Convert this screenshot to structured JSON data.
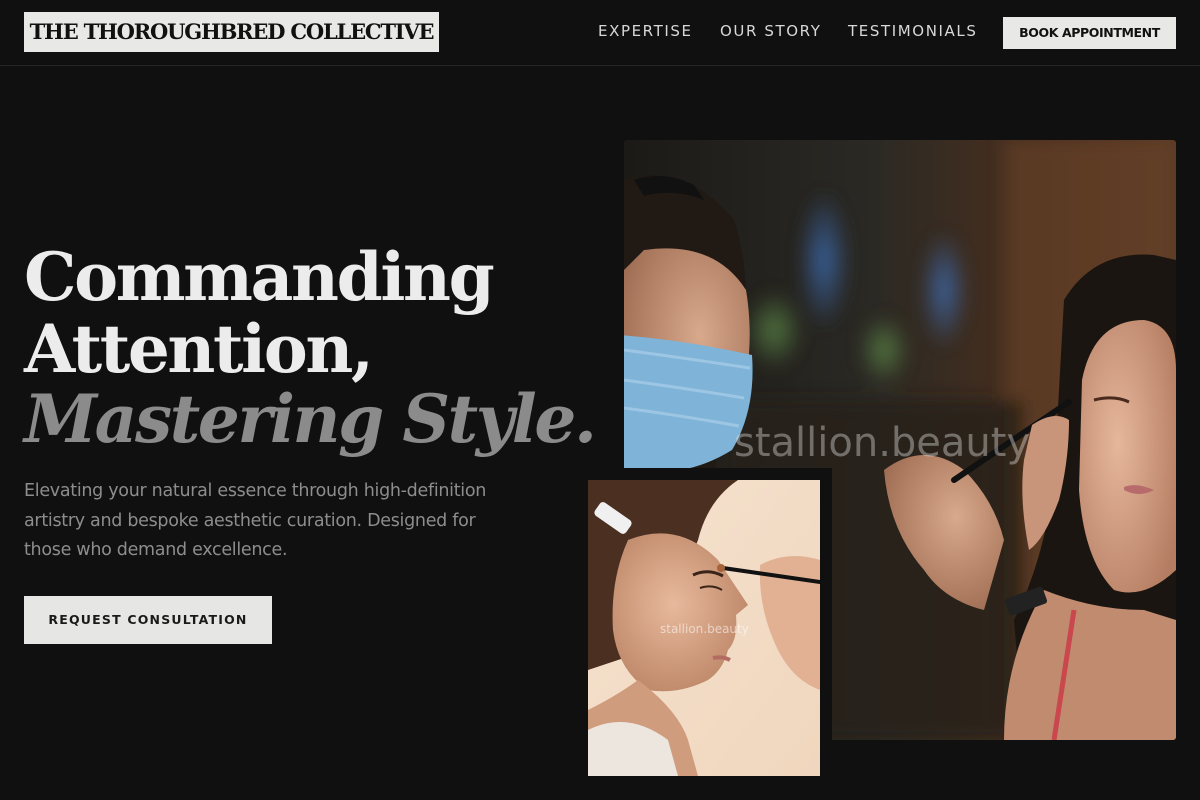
{
  "brand": {
    "name": "THE THOROUGHBRED COLLECTIVE"
  },
  "nav": {
    "links": [
      "EXPERTISE",
      "OUR STORY",
      "TESTIMONIALS"
    ],
    "cta_label": "BOOK APPOINTMENT"
  },
  "hero": {
    "line1": "Commanding",
    "line2": "Attention,",
    "line3": "Mastering Style.",
    "description": "Elevating your natural essence through high-definition artistry and bespoke aesthetic curation. Designed for those who demand excellence.",
    "cta_label": "REQUEST CONSULTATION"
  },
  "images": {
    "main_watermark": "stallion.beauty",
    "small_watermark": "stallion.beauty"
  },
  "colors": {
    "background": "#101010",
    "surface_light": "#e8e8e6",
    "text_primary": "#ececec",
    "text_muted": "#8d8d8d"
  }
}
